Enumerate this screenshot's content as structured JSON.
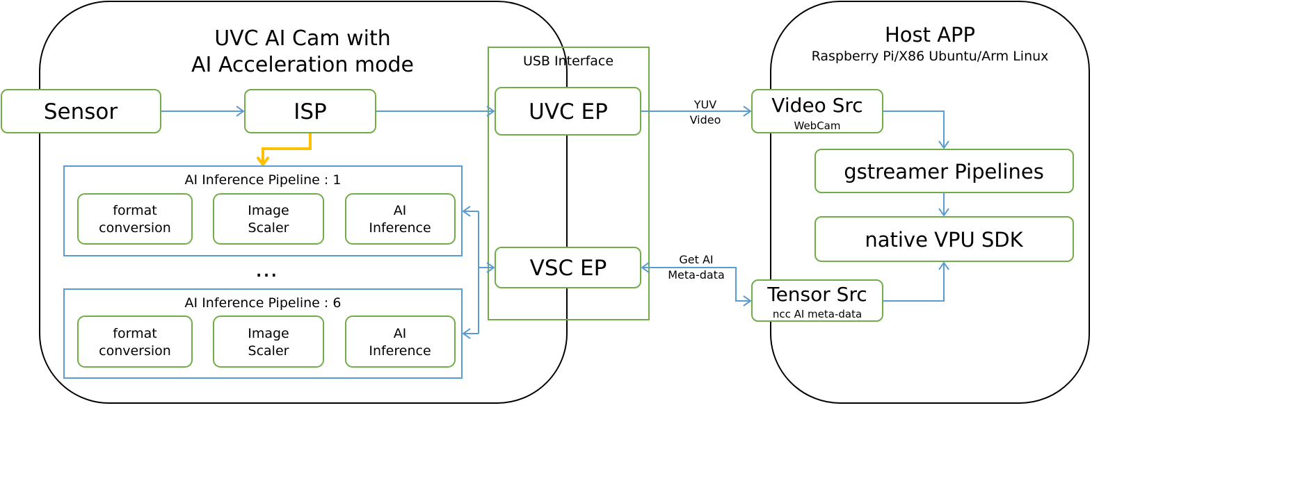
{
  "camera": {
    "title_line1": "UVC AI Cam with",
    "title_line2": "AI Acceleration mode"
  },
  "usb": {
    "label": "USB Interface",
    "uvc_ep": "UVC EP",
    "vsc_ep": "VSC EP"
  },
  "sensor": "Sensor",
  "isp": "ISP",
  "pipelines": [
    {
      "label": "AI  Inference Pipeline : 1",
      "stages": [
        [
          "format",
          "conversion"
        ],
        [
          "Image",
          "Scaler"
        ],
        [
          "AI",
          "Inference"
        ]
      ]
    },
    {
      "label": "AI  Inference Pipeline : 6",
      "stages": [
        [
          "format",
          "conversion"
        ],
        [
          "Image",
          "Scaler"
        ],
        [
          "AI",
          "Inference"
        ]
      ]
    }
  ],
  "ellipsis": "...",
  "links": {
    "yuv_line1": "YUV",
    "yuv_line2": "Video",
    "meta_line1": "Get AI",
    "meta_line2": "Meta-data"
  },
  "host": {
    "title": "Host APP",
    "subtitle": "Raspberry Pi/X86 Ubuntu/Arm Linux",
    "video_src": "Video Src",
    "video_src_sub": "WebCam",
    "gstreamer": "gstreamer Pipelines",
    "vpu_sdk": "native VPU SDK",
    "tensor_src": "Tensor Src",
    "tensor_src_sub": "ncc AI meta-data"
  },
  "colors": {
    "box_border": "#70ad47",
    "pipeline_border": "#5b9bd5",
    "arrow": "#5b9bd5",
    "isp_to_pipeline": "#ffc000"
  }
}
